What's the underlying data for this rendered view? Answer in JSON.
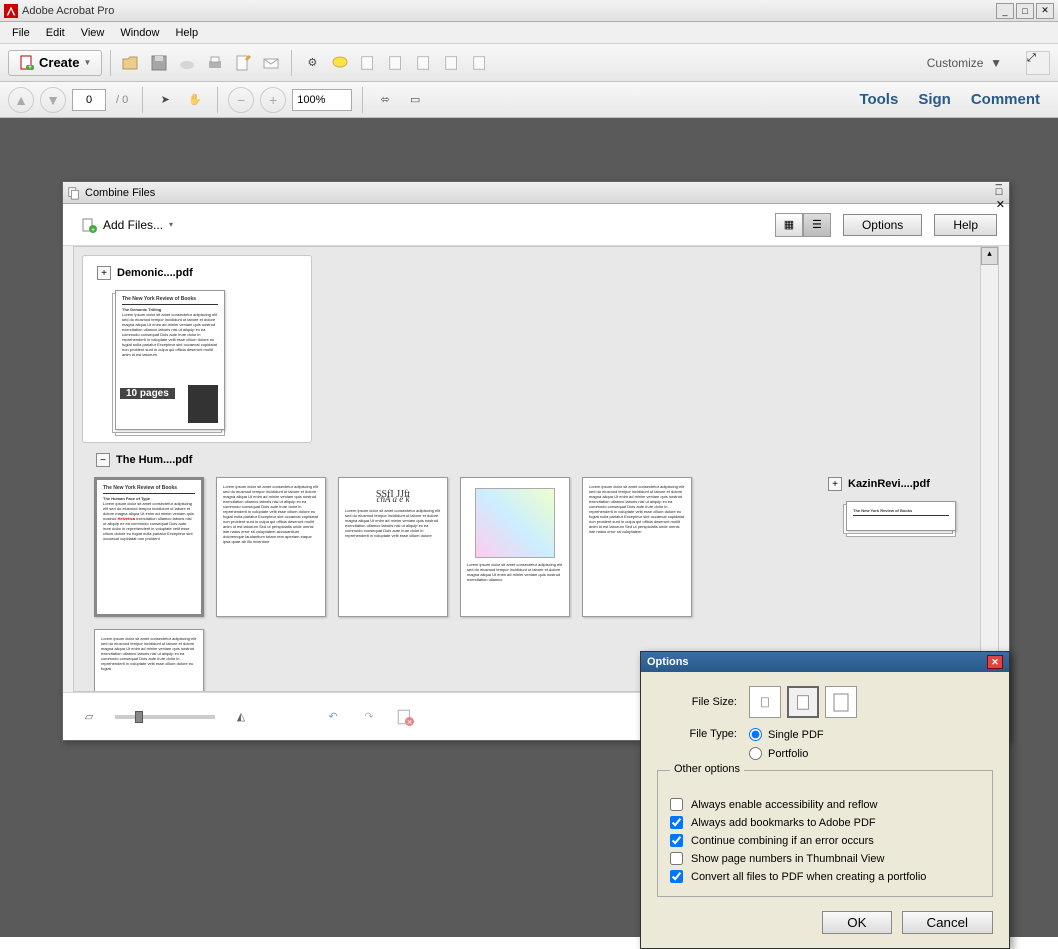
{
  "app": {
    "title": "Adobe Acrobat Pro"
  },
  "menu": [
    "File",
    "Edit",
    "View",
    "Window",
    "Help"
  ],
  "toolbar": {
    "create": "Create",
    "customize": "Customize"
  },
  "nav": {
    "page": "0",
    "total": "/ 0",
    "zoom": "100%"
  },
  "rightlinks": {
    "tools": "Tools",
    "sign": "Sign",
    "comment": "Comment"
  },
  "combine": {
    "title": "Combine Files",
    "addfiles": "Add Files...",
    "options": "Options",
    "help": "Help",
    "files": [
      {
        "name": "Demonic....pdf",
        "pages_label": "10 pages",
        "selected": true,
        "collapsed": true
      },
      {
        "name": "The Hum....pdf",
        "collapsed": false
      },
      {
        "name": "KazinRevi....pdf",
        "collapsed": true
      }
    ]
  },
  "options_dialog": {
    "title": "Options",
    "filesize_label": "File Size:",
    "filetype_label": "File Type:",
    "filetype_opts": [
      "Single PDF",
      "Portfolio"
    ],
    "filetype_selected": 0,
    "other_legend": "Other options",
    "checks": [
      {
        "label": "Always enable accessibility and reflow",
        "checked": false
      },
      {
        "label": "Always add bookmarks to Adobe PDF",
        "checked": true
      },
      {
        "label": "Continue combining if an error occurs",
        "checked": true
      },
      {
        "label": "Show page numbers in Thumbnail View",
        "checked": false
      },
      {
        "label": "Convert all files to PDF when creating a portfolio",
        "checked": true
      }
    ],
    "ok": "OK",
    "cancel": "Cancel"
  }
}
